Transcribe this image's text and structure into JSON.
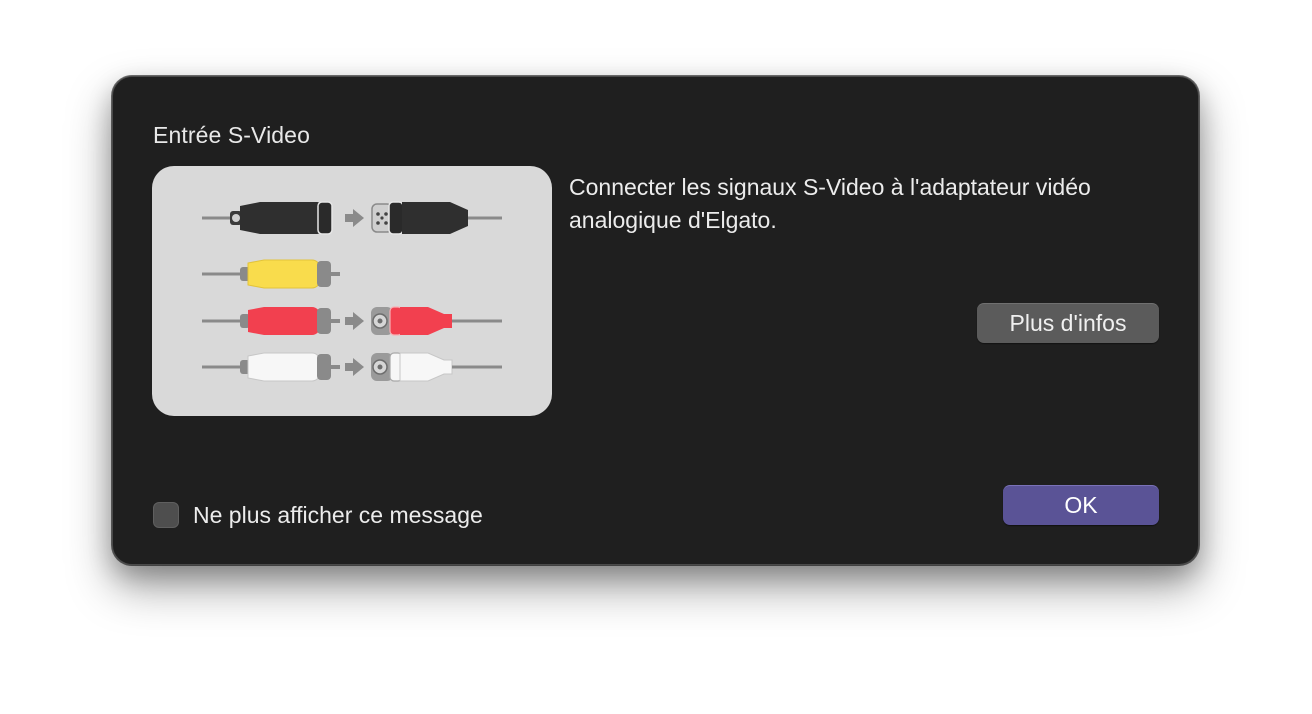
{
  "dialog": {
    "title": "Entrée S-Video",
    "message": "Connecter les signaux S-Video à l'adaptateur vidéo analogique d'Elgato.",
    "more_info_label": "Plus d'infos",
    "ok_label": "OK",
    "dont_show_label": "Ne plus afficher ce message",
    "dont_show_checked": false
  },
  "illustration": {
    "icon": "s-video-and-rca-cables-diagram",
    "connector_colors": {
      "s_video": "#2e2e2e",
      "composite": "#f9dc4c",
      "audio_left": "#f2404f",
      "audio_right": "#f7f7f7"
    }
  },
  "colors": {
    "dialog_background": "#1f1f1f",
    "ok_button": "#5a5396",
    "secondary_button": "#5b5b5b"
  }
}
